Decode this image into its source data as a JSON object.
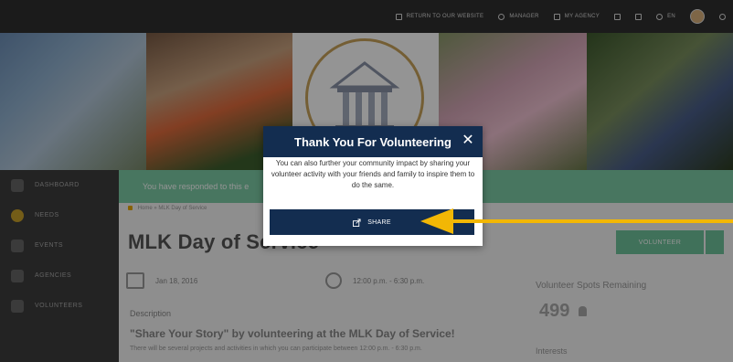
{
  "topnav": {
    "return_label": "RETURN TO OUR WEBSITE",
    "manager_label": "MANAGER",
    "agency_label": "MY AGENCY",
    "lang_label": "EN"
  },
  "sidebar": {
    "items": [
      {
        "label": "DASHBOARD"
      },
      {
        "label": "NEEDS"
      },
      {
        "label": "EVENTS"
      },
      {
        "label": "AGENCIES"
      },
      {
        "label": "VOLUNTEERS"
      }
    ]
  },
  "alert": {
    "text": "You have responded to this e"
  },
  "breadcrumb": {
    "home": "Home",
    "sep": "»",
    "current": "MLK Day of Service"
  },
  "event": {
    "title": "MLK Day of Service",
    "date": "Jan 18, 2016",
    "time": "12:00 p.m. - 6:30 p.m.",
    "volunteer_button": "VOLUNTEER",
    "spots_label": "Volunteer Spots Remaining",
    "spots_count": "499",
    "description_heading": "Description",
    "story_heading": "\"Share Your Story\" by volunteering at the MLK Day of Service!",
    "body_text": "There will be several projects and activities in which you can participate between 12:00 p.m. - 6:30 p.m.",
    "interests_label": "Interests"
  },
  "modal": {
    "title": "Thank You For Volunteering",
    "body": "You can also further your community impact by sharing your volunteer activity with your friends and family to inspire them to do the same.",
    "share_label": "SHARE",
    "close_glyph": "✕"
  },
  "colors": {
    "modal_header": "#132d50",
    "arrow": "#f2b705",
    "alert": "#7ccba6",
    "active_nav": "#c9a12a"
  },
  "icons": {
    "share": "share-icon",
    "close": "close-icon",
    "calendar": "calendar-icon",
    "clock": "clock-icon",
    "person": "person-icon",
    "arrow": "pointer-arrow-icon"
  }
}
